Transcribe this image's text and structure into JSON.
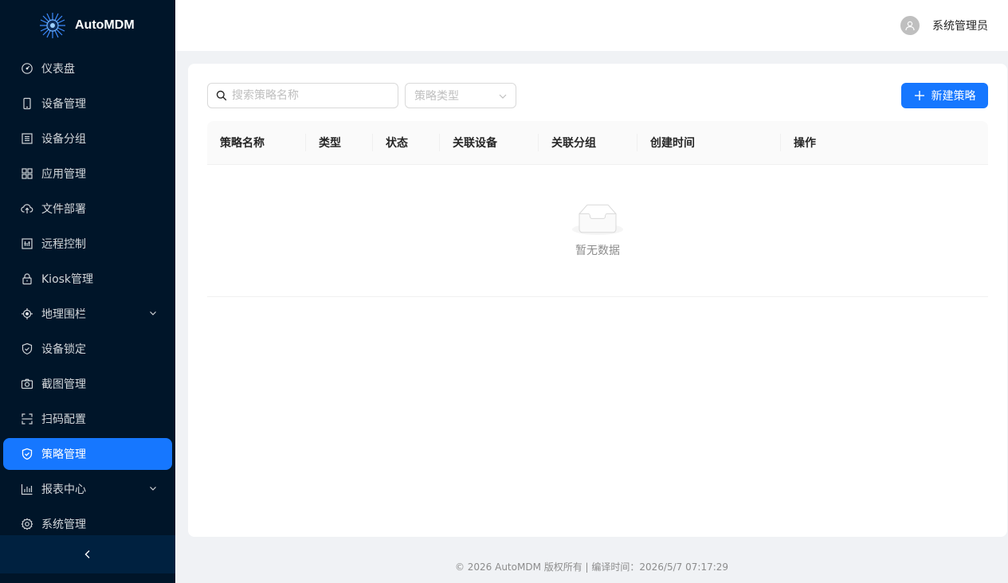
{
  "app": {
    "name": "AutoMDM"
  },
  "sidebar": {
    "items": [
      {
        "label": "仪表盘",
        "icon": "dashboard-icon"
      },
      {
        "label": "设备管理",
        "icon": "mobile-icon"
      },
      {
        "label": "设备分组",
        "icon": "group-icon"
      },
      {
        "label": "应用管理",
        "icon": "appstore-icon"
      },
      {
        "label": "文件部署",
        "icon": "cloud-upload-icon"
      },
      {
        "label": "远程控制",
        "icon": "remote-icon"
      },
      {
        "label": "Kiosk管理",
        "icon": "lock-icon"
      },
      {
        "label": "地理围栏",
        "icon": "aim-icon",
        "expandable": true
      },
      {
        "label": "设备锁定",
        "icon": "shield-icon"
      },
      {
        "label": "截图管理",
        "icon": "camera-icon"
      },
      {
        "label": "扫码配置",
        "icon": "scan-icon"
      },
      {
        "label": "策略管理",
        "icon": "safety-icon",
        "active": true
      },
      {
        "label": "报表中心",
        "icon": "bar-chart-icon",
        "expandable": true
      },
      {
        "label": "系统管理",
        "icon": "setting-icon"
      }
    ]
  },
  "header": {
    "username": "系统管理员"
  },
  "toolbar": {
    "search_placeholder": "搜索策略名称",
    "type_placeholder": "策略类型",
    "new_label": "新建策略"
  },
  "table": {
    "columns": [
      "策略名称",
      "类型",
      "状态",
      "关联设备",
      "关联分组",
      "创建时间",
      "操作"
    ],
    "rows": [],
    "empty_text": "暂无数据"
  },
  "footer": {
    "text": "© 2026 AutoMDM 版权所有 | 编译时间：2026/5/7 07:17:29"
  },
  "colors": {
    "sidebar_bg": "#001529",
    "primary": "#1677ff"
  }
}
